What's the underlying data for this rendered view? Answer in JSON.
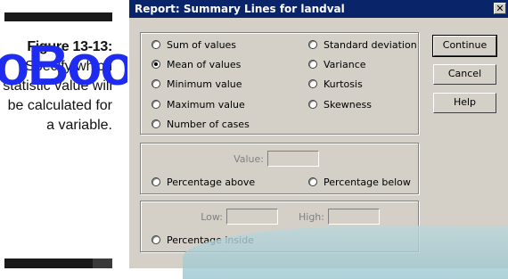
{
  "book": {
    "watermark": "oBooks",
    "figure_label": "Figure 13-13:",
    "caption": "Specify which statistic value will be calculated for a variable."
  },
  "dialog": {
    "title": "Report: Summary Lines for landval",
    "close_glyph": "✕",
    "statistics_left": [
      "Sum of values",
      "Mean of values",
      "Minimum value",
      "Maximum value",
      "Number of cases"
    ],
    "statistics_right": [
      "Standard deviation",
      "Variance",
      "Kurtosis",
      "Skewness"
    ],
    "value_label": "Value:",
    "percentage_above": "Percentage above",
    "percentage_below": "Percentage below",
    "low_label": "Low:",
    "high_label": "High:",
    "percentage_inside": "Percentage inside",
    "buttons": {
      "continue": "Continue",
      "cancel": "Cancel",
      "help": "Help"
    },
    "selected_statistic": "Mean of values"
  }
}
